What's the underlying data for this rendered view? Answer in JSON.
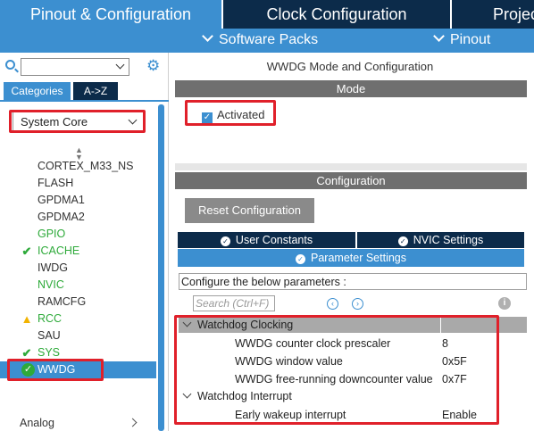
{
  "top_tabs": [
    "Pinout & Configuration",
    "Clock Configuration",
    "Project Manager"
  ],
  "sub_menu": {
    "software_packs": "Software Packs",
    "pinout": "Pinout"
  },
  "left": {
    "tabs": [
      "Categories",
      "A->Z"
    ],
    "category": "System Core",
    "peripherals": [
      {
        "label": "CORTEX_M33_NS",
        "status": "none"
      },
      {
        "label": "FLASH",
        "status": "none"
      },
      {
        "label": "GPDMA1",
        "status": "none"
      },
      {
        "label": "GPDMA2",
        "status": "none"
      },
      {
        "label": "GPIO",
        "status": "green"
      },
      {
        "label": "ICACHE",
        "status": "check"
      },
      {
        "label": "IWDG",
        "status": "none"
      },
      {
        "label": "NVIC",
        "status": "green"
      },
      {
        "label": "RAMCFG",
        "status": "none"
      },
      {
        "label": "RCC",
        "status": "warning"
      },
      {
        "label": "SAU",
        "status": "none"
      },
      {
        "label": "SYS",
        "status": "check"
      },
      {
        "label": "WWDG",
        "status": "selected"
      }
    ],
    "next_category": "Analog"
  },
  "right": {
    "title": "WWDG Mode and Configuration",
    "mode_header": "Mode",
    "activated_label": "Activated",
    "activated_checked": true,
    "config_header": "Configuration",
    "reset_button": "Reset Configuration",
    "tabs": [
      "User Constants",
      "NVIC Settings",
      "Parameter Settings"
    ],
    "active_tab": "Parameter Settings",
    "configure_label": "Configure the below parameters :",
    "search_placeholder": "Search (Ctrl+F)",
    "groups": [
      {
        "name": "Watchdog Clocking",
        "params": [
          {
            "name": "WWDG counter clock prescaler",
            "value": "8"
          },
          {
            "name": "WWDG window value",
            "value": "0x5F"
          },
          {
            "name": "WWDG free-running downcounter value",
            "value": "0x7F"
          }
        ]
      },
      {
        "name": "Watchdog Interrupt",
        "params": [
          {
            "name": "Early wakeup interrupt",
            "value": "Enable"
          }
        ]
      }
    ]
  },
  "colors": {
    "accent": "#3c8fd0",
    "dark": "#0c2b4a",
    "ok": "#2eaa3a",
    "warning": "#f2b300",
    "highlight": "#e0202a"
  }
}
